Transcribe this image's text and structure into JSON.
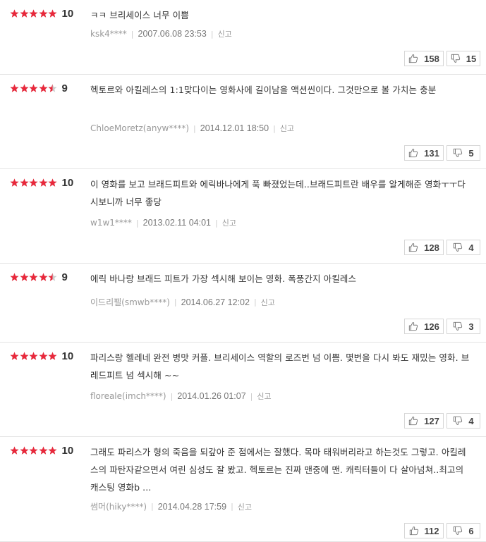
{
  "colors": {
    "star_filled": "#e8283b",
    "star_empty": "#cccccc",
    "text": "#333333",
    "muted": "#999999"
  },
  "icons": {
    "rating": "star-icon",
    "like": "thumbs-up-icon",
    "dislike": "thumbs-down-icon"
  },
  "reviews": [
    {
      "rating": 10,
      "score": "10",
      "comment": "ㅋㅋ 브리세이스 너무 이쁨",
      "user": "ksk4****",
      "date": "2007.06.08 23:53",
      "report": "신고",
      "likes": "158",
      "dislikes": "15"
    },
    {
      "rating": 9,
      "score": "9",
      "comment": "헥토르와 아킬레스의 1:1맞다이는 영화사에 길이남을 액션씬이다. 그것만으로 볼 가치는 충분",
      "user": "ChloeMoretz(anyw****)",
      "date": "2014.12.01 18:50",
      "report": "신고",
      "likes": "131",
      "dislikes": "5"
    },
    {
      "rating": 10,
      "score": "10",
      "comment": "이 영화를 보고 브래드피트와 에릭바나에게 푹 빠졌었는데..브래드피트란 배우를 알게해준 영화ㅜㅜ다시보니까 너무 좋당",
      "user": "w1w1****",
      "date": "2013.02.11 04:01",
      "report": "신고",
      "likes": "128",
      "dislikes": "4"
    },
    {
      "rating": 9,
      "score": "9",
      "comment": "에릭 바나랑 브래드 피트가 가장 섹시해 보이는 영화. 폭풍간지 아킬레스",
      "user": "이드리펠(smwb****)",
      "date": "2014.06.27 12:02",
      "report": "신고",
      "likes": "126",
      "dislikes": "3"
    },
    {
      "rating": 10,
      "score": "10",
      "comment": "파리스랑 헬레네 완전 병맛 커플. 브리세이스 역할의 로즈번 넘 이쁨. 몇번을 다시 봐도 재밌는 영화. 브레드피트 넘 섹시해 ~~",
      "user": "floreale(imch****)",
      "date": "2014.01.26 01:07",
      "report": "신고",
      "likes": "127",
      "dislikes": "4"
    },
    {
      "rating": 10,
      "score": "10",
      "comment": "그래도 파리스가 형의 죽음을 되갚아 준 점에서는 잘했다. 목마 태워버리라고 하는것도 그렇고. 아킬레스의 파탄자같으면서 여린 심성도 잘 봤고. 헥토르는 진짜 맨중에 맨. 캐릭터들이 다 살아넘쳐..최고의 캐스팅 영화b ...",
      "user": "썸머(hiky****)",
      "date": "2014.04.28 17:59",
      "report": "신고",
      "likes": "112",
      "dislikes": "6"
    }
  ]
}
